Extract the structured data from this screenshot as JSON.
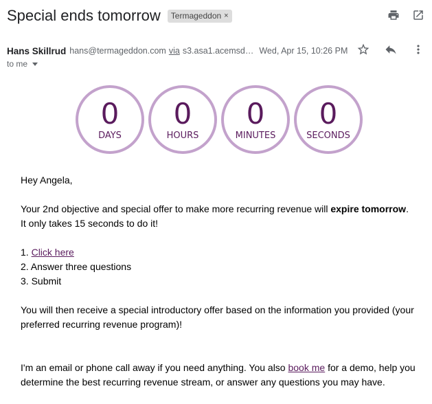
{
  "email": {
    "subject": "Special ends tomorrow",
    "label_chip": "Termageddon",
    "label_close": "×",
    "sender_name": "Hans Skillrud",
    "sender_email": "hans@termageddon.com",
    "via_label": "via",
    "via_domain": "s3.asa1.acemsd…",
    "date": "Wed, Apr 15, 10:26 PM",
    "to_label": "to me"
  },
  "icons": {
    "print": "print-icon",
    "open_new": "open-in-new-window-icon",
    "star": "star-icon",
    "reply": "reply-icon",
    "more": "more-vertical-icon"
  },
  "countdown": [
    {
      "value": "0",
      "unit": "DAYS"
    },
    {
      "value": "0",
      "unit": "HOURS"
    },
    {
      "value": "0",
      "unit": "MINUTES"
    },
    {
      "value": "0",
      "unit": "SECONDS"
    }
  ],
  "body": {
    "greeting": "Hey Angela,",
    "para1_a": "Your 2nd objective and special offer to make more recurring revenue will ",
    "para1_bold": "expire tomorrow",
    "para1_b": ".",
    "para1_line2": "It only takes 15 seconds to do it!",
    "step1_prefix": "1. ",
    "step1_link": "Click here",
    "step2": "2. Answer three questions",
    "step3": "3. Submit",
    "para2": "You will then receive a special introductory offer based on the information you provided (your preferred recurring revenue program)!",
    "para3_a": "I'm an email or phone call away if you need anything. You also ",
    "para3_link": "book me",
    "para3_b": " for a demo, help you determine the best recurring revenue stream, or answer any questions you may have."
  },
  "colors": {
    "accent": "#5a1b5d",
    "ring": "#c3a2cc",
    "chip_bg": "#dddddd"
  }
}
